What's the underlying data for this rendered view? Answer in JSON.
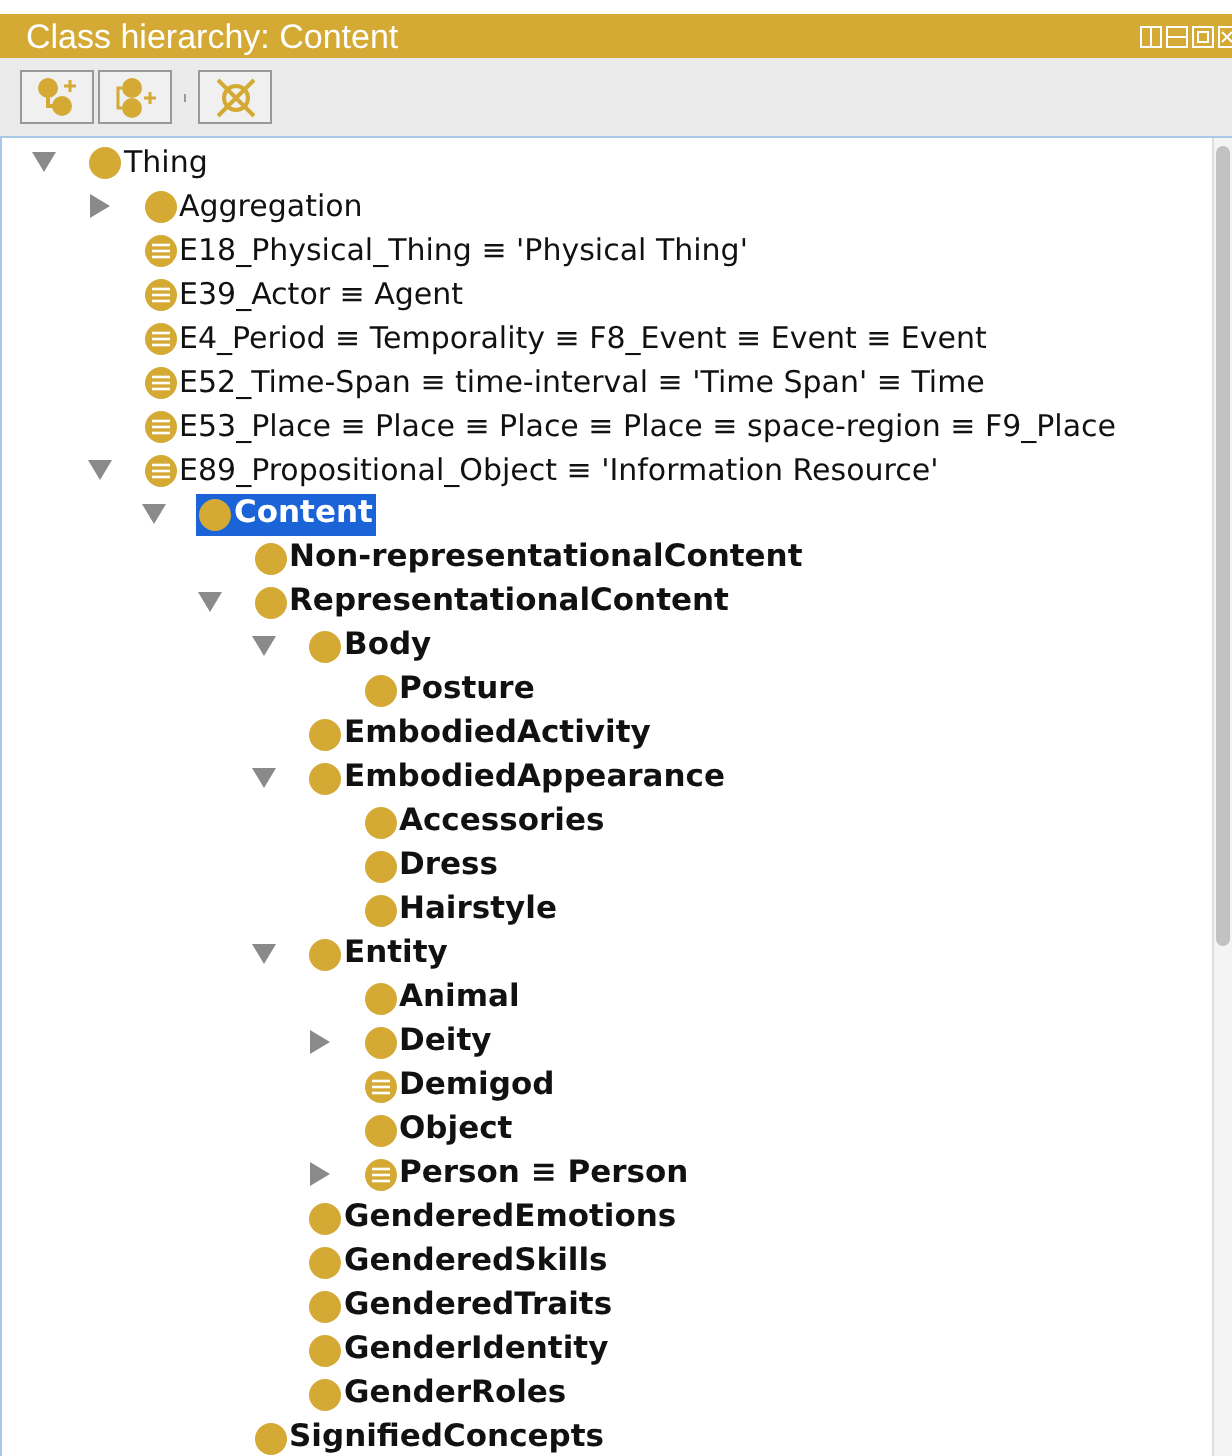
{
  "panel": {
    "title": "Class hierarchy: Content"
  },
  "tree": [
    {
      "label": "Thing",
      "kind": "class",
      "bold": false,
      "selected": false,
      "expanded": true,
      "children": [
        {
          "label": "Aggregation",
          "kind": "class",
          "bold": false,
          "selected": false,
          "expanded": false
        },
        {
          "label": "E18_Physical_Thing ≡ 'Physical Thing'",
          "kind": "equivalent",
          "bold": false,
          "selected": false
        },
        {
          "label": "E39_Actor ≡ Agent",
          "kind": "equivalent",
          "bold": false,
          "selected": false
        },
        {
          "label": "E4_Period ≡ Temporality ≡ F8_Event ≡ Event ≡ Event",
          "kind": "equivalent",
          "bold": false,
          "selected": false
        },
        {
          "label": "E52_Time-Span ≡ time-interval ≡ 'Time Span' ≡ Time",
          "kind": "equivalent",
          "bold": false,
          "selected": false
        },
        {
          "label": "E53_Place ≡ Place ≡ Place ≡ Place ≡ space-region ≡ F9_Place",
          "kind": "equivalent",
          "bold": false,
          "selected": false
        },
        {
          "label": "E89_Propositional_Object ≡ 'Information Resource'",
          "kind": "equivalent",
          "bold": false,
          "selected": false,
          "expanded": true,
          "children": [
            {
              "label": "Content",
              "kind": "class",
              "bold": true,
              "selected": true,
              "expanded": true,
              "children": [
                {
                  "label": "Non-representationalContent",
                  "kind": "class",
                  "bold": true,
                  "selected": false
                },
                {
                  "label": "RepresentationalContent",
                  "kind": "class",
                  "bold": true,
                  "selected": false,
                  "expanded": true,
                  "children": [
                    {
                      "label": "Body",
                      "kind": "class",
                      "bold": true,
                      "selected": false,
                      "expanded": true,
                      "children": [
                        {
                          "label": "Posture",
                          "kind": "class",
                          "bold": true,
                          "selected": false
                        }
                      ]
                    },
                    {
                      "label": "EmbodiedActivity",
                      "kind": "class",
                      "bold": true,
                      "selected": false
                    },
                    {
                      "label": "EmbodiedAppearance",
                      "kind": "class",
                      "bold": true,
                      "selected": false,
                      "expanded": true,
                      "children": [
                        {
                          "label": "Accessories",
                          "kind": "class",
                          "bold": true,
                          "selected": false
                        },
                        {
                          "label": "Dress",
                          "kind": "class",
                          "bold": true,
                          "selected": false
                        },
                        {
                          "label": "Hairstyle",
                          "kind": "class",
                          "bold": true,
                          "selected": false
                        }
                      ]
                    },
                    {
                      "label": "Entity",
                      "kind": "class",
                      "bold": true,
                      "selected": false,
                      "expanded": true,
                      "children": [
                        {
                          "label": "Animal",
                          "kind": "class",
                          "bold": true,
                          "selected": false
                        },
                        {
                          "label": "Deity",
                          "kind": "class",
                          "bold": true,
                          "selected": false,
                          "expanded": false
                        },
                        {
                          "label": "Demigod",
                          "kind": "equivalent",
                          "bold": true,
                          "selected": false
                        },
                        {
                          "label": "Object",
                          "kind": "class",
                          "bold": true,
                          "selected": false
                        },
                        {
                          "label": "Person ≡ Person",
                          "kind": "equivalent",
                          "bold": true,
                          "selected": false,
                          "expanded": false
                        }
                      ]
                    },
                    {
                      "label": "GenderedEmotions",
                      "kind": "class",
                      "bold": true,
                      "selected": false
                    },
                    {
                      "label": "GenderedSkills",
                      "kind": "class",
                      "bold": true,
                      "selected": false
                    },
                    {
                      "label": "GenderedTraits",
                      "kind": "class",
                      "bold": true,
                      "selected": false
                    },
                    {
                      "label": "GenderIdentity",
                      "kind": "class",
                      "bold": true,
                      "selected": false
                    },
                    {
                      "label": "GenderRoles",
                      "kind": "class",
                      "bold": true,
                      "selected": false
                    }
                  ]
                },
                {
                  "label": "SignifiedConcepts",
                  "kind": "class",
                  "bold": true,
                  "selected": false
                }
              ]
            }
          ]
        }
      ]
    }
  ]
}
